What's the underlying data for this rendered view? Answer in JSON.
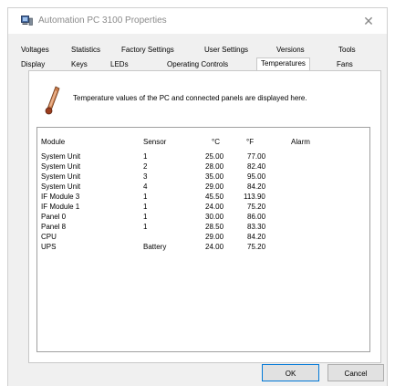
{
  "window": {
    "title": "Automation PC 3100 Properties",
    "close_glyph": "✕"
  },
  "tabs": {
    "row1": [
      "Voltages",
      "Statistics",
      "Factory Settings",
      "User Settings",
      "Versions",
      "Tools"
    ],
    "row2": [
      "Display",
      "Keys",
      "LEDs",
      "Operating Controls",
      "Temperatures",
      "Fans"
    ],
    "active": "Temperatures"
  },
  "panel": {
    "icon": "thermometer-icon",
    "description": "Temperature values of the PC and connected panels are displayed here."
  },
  "table": {
    "headers": {
      "module": "Module",
      "sensor": "Sensor",
      "celsius": "°C",
      "fahrenheit": "°F",
      "alarm": "Alarm"
    },
    "rows": [
      {
        "module": "System Unit",
        "sensor": "1",
        "celsius": "25.00",
        "fahrenheit": "77.00",
        "alarm": ""
      },
      {
        "module": "System Unit",
        "sensor": "2",
        "celsius": "28.00",
        "fahrenheit": "82.40",
        "alarm": ""
      },
      {
        "module": "System Unit",
        "sensor": "3",
        "celsius": "35.00",
        "fahrenheit": "95.00",
        "alarm": ""
      },
      {
        "module": "System Unit",
        "sensor": "4",
        "celsius": "29.00",
        "fahrenheit": "84.20",
        "alarm": ""
      },
      {
        "module": "IF Module 3",
        "sensor": "1",
        "celsius": "45.50",
        "fahrenheit": "113.90",
        "alarm": ""
      },
      {
        "module": "IF Module 1",
        "sensor": "1",
        "celsius": "24.00",
        "fahrenheit": "75.20",
        "alarm": ""
      },
      {
        "module": "Panel 0",
        "sensor": "1",
        "celsius": "30.00",
        "fahrenheit": "86.00",
        "alarm": ""
      },
      {
        "module": "Panel 8",
        "sensor": "1",
        "celsius": "28.50",
        "fahrenheit": "83.30",
        "alarm": ""
      },
      {
        "module": "CPU",
        "sensor": "",
        "celsius": "29.00",
        "fahrenheit": "84.20",
        "alarm": ""
      },
      {
        "module": "UPS",
        "sensor": "Battery",
        "celsius": "24.00",
        "fahrenheit": "75.20",
        "alarm": ""
      }
    ]
  },
  "buttons": {
    "ok": "OK",
    "cancel": "Cancel"
  },
  "colors": {
    "window_bg": "#f0f0f0",
    "panel_bg": "#ffffff",
    "ok_border": "#0078d7"
  }
}
